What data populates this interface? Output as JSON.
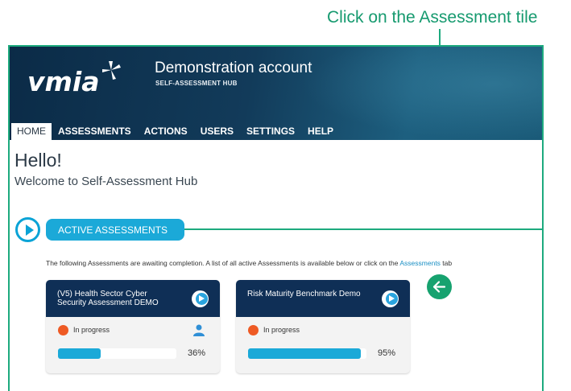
{
  "callout": {
    "text": "Click on the Assessment tile"
  },
  "header": {
    "logo_text": "vmia",
    "account_title": "Demonstration account",
    "account_subtitle": "SELF-ASSESSMENT HUB"
  },
  "nav": {
    "items": [
      {
        "label": "HOME",
        "active": true
      },
      {
        "label": "ASSESSMENTS",
        "active": false
      },
      {
        "label": "ACTIONS",
        "active": false
      },
      {
        "label": "USERS",
        "active": false
      },
      {
        "label": "SETTINGS",
        "active": false
      },
      {
        "label": "HELP",
        "active": false
      }
    ]
  },
  "main": {
    "hello": "Hello!",
    "welcome": "Welcome to Self-Assessment Hub",
    "section_label": "ACTIVE ASSESSMENTS",
    "intro_text": "The following Assessments are awaiting completion. A list of all active Assessments is available below or click on the ",
    "intro_link": "Assessments",
    "intro_tail": " tab"
  },
  "cards": [
    {
      "title": "(V5) Health Sector Cyber Security Assessment DEMO",
      "status": "In progress",
      "progress": 36,
      "progress_label": "36%",
      "has_user_icon": true
    },
    {
      "title": "Risk Maturity Benchmark Demo",
      "status": "In progress",
      "progress": 95,
      "progress_label": "95%",
      "has_user_icon": false
    }
  ],
  "colors": {
    "accent_green": "#1daa7e",
    "header_navy": "#0f2f56",
    "progress_blue": "#1ba9d8",
    "status_orange": "#ee5a24"
  },
  "icons": [
    "logo-star-icon",
    "play-icon",
    "user-icon",
    "arrow-left-icon"
  ]
}
